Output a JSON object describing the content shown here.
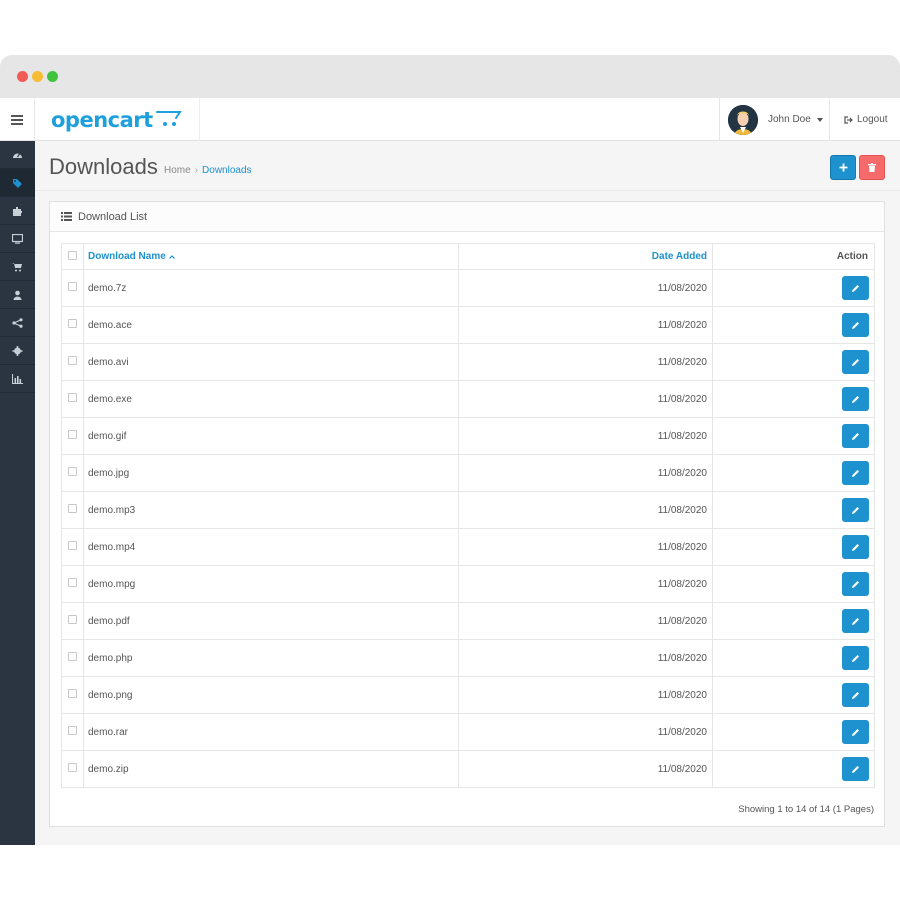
{
  "header": {
    "brand": "opencart",
    "user_name": "John Doe",
    "logout_label": "Logout"
  },
  "sidebar": {
    "items": [
      {
        "icon": "dashboard-icon"
      },
      {
        "icon": "tag-icon",
        "active": true
      },
      {
        "icon": "puzzle-icon"
      },
      {
        "icon": "desktop-icon"
      },
      {
        "icon": "cart-icon"
      },
      {
        "icon": "user-icon"
      },
      {
        "icon": "share-icon"
      },
      {
        "icon": "cog-icon"
      },
      {
        "icon": "bar-chart-icon"
      }
    ]
  },
  "page": {
    "title": "Downloads",
    "breadcrumb": [
      "Home",
      "Downloads"
    ]
  },
  "panel": {
    "heading": "Download List",
    "columns": {
      "name": "Download Name",
      "date": "Date Added",
      "action": "Action"
    },
    "rows": [
      {
        "name": "demo.7z",
        "date": "11/08/2020"
      },
      {
        "name": "demo.ace",
        "date": "11/08/2020"
      },
      {
        "name": "demo.avi",
        "date": "11/08/2020"
      },
      {
        "name": "demo.exe",
        "date": "11/08/2020"
      },
      {
        "name": "demo.gif",
        "date": "11/08/2020"
      },
      {
        "name": "demo.jpg",
        "date": "11/08/2020"
      },
      {
        "name": "demo.mp3",
        "date": "11/08/2020"
      },
      {
        "name": "demo.mp4",
        "date": "11/08/2020"
      },
      {
        "name": "demo.mpg",
        "date": "11/08/2020"
      },
      {
        "name": "demo.pdf",
        "date": "11/08/2020"
      },
      {
        "name": "demo.php",
        "date": "11/08/2020"
      },
      {
        "name": "demo.png",
        "date": "11/08/2020"
      },
      {
        "name": "demo.rar",
        "date": "11/08/2020"
      },
      {
        "name": "demo.zip",
        "date": "11/08/2020"
      }
    ],
    "pagination_text": "Showing 1 to 14 of 14 (1 Pages)"
  },
  "colors": {
    "accent": "#1e91cf",
    "danger": "#f56b6b",
    "sidebar_bg": "#2a3541"
  }
}
